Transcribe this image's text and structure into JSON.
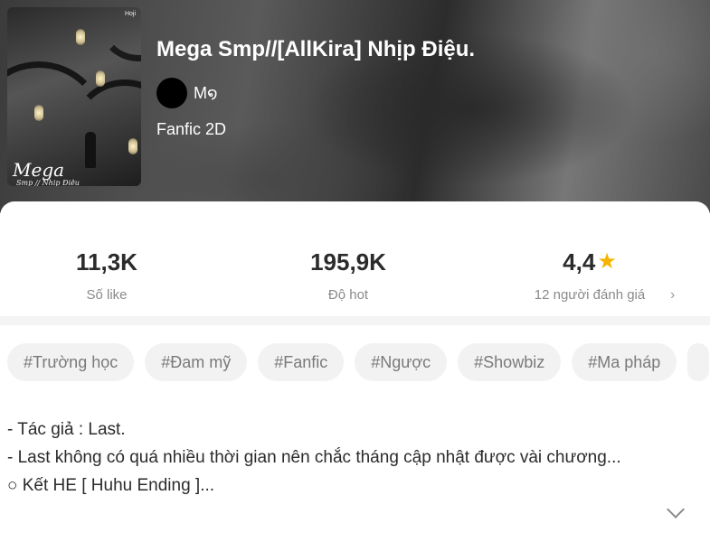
{
  "story": {
    "title": "Mega Smp//[AllKira] Nhịp Điệu.",
    "author_name": "M໑",
    "genre": "Fanfic 2D",
    "cover": {
      "badge": "Hoji",
      "title_text": "Mega",
      "subtitle_text": "Smp // Nhịp Điệu"
    }
  },
  "stats": {
    "likes": {
      "value": "11,3K",
      "label": "Số like"
    },
    "hot": {
      "value": "195,9K",
      "label": "Độ hot"
    },
    "rating": {
      "value": "4,4",
      "label": "12 người đánh giá",
      "icon": "star-icon"
    }
  },
  "tags": [
    "#Trường học",
    "#Đam mỹ",
    "#Fanfic",
    "#Ngược",
    "#Showbiz",
    "#Ma pháp"
  ],
  "description": {
    "lines": [
      "- Tác giả : Last.",
      "- Last không có quá nhiều thời gian nên chắc tháng cập nhật được vài chương...",
      "○ Kết HE [ Huhu Ending ]..."
    ]
  },
  "icons": {
    "rating_arrow": "chevron-right-icon",
    "expand": "chevron-down-icon"
  },
  "colors": {
    "star": "#f5b400",
    "muted_text": "#8a8a8a",
    "tag_bg": "#f2f2f2"
  }
}
